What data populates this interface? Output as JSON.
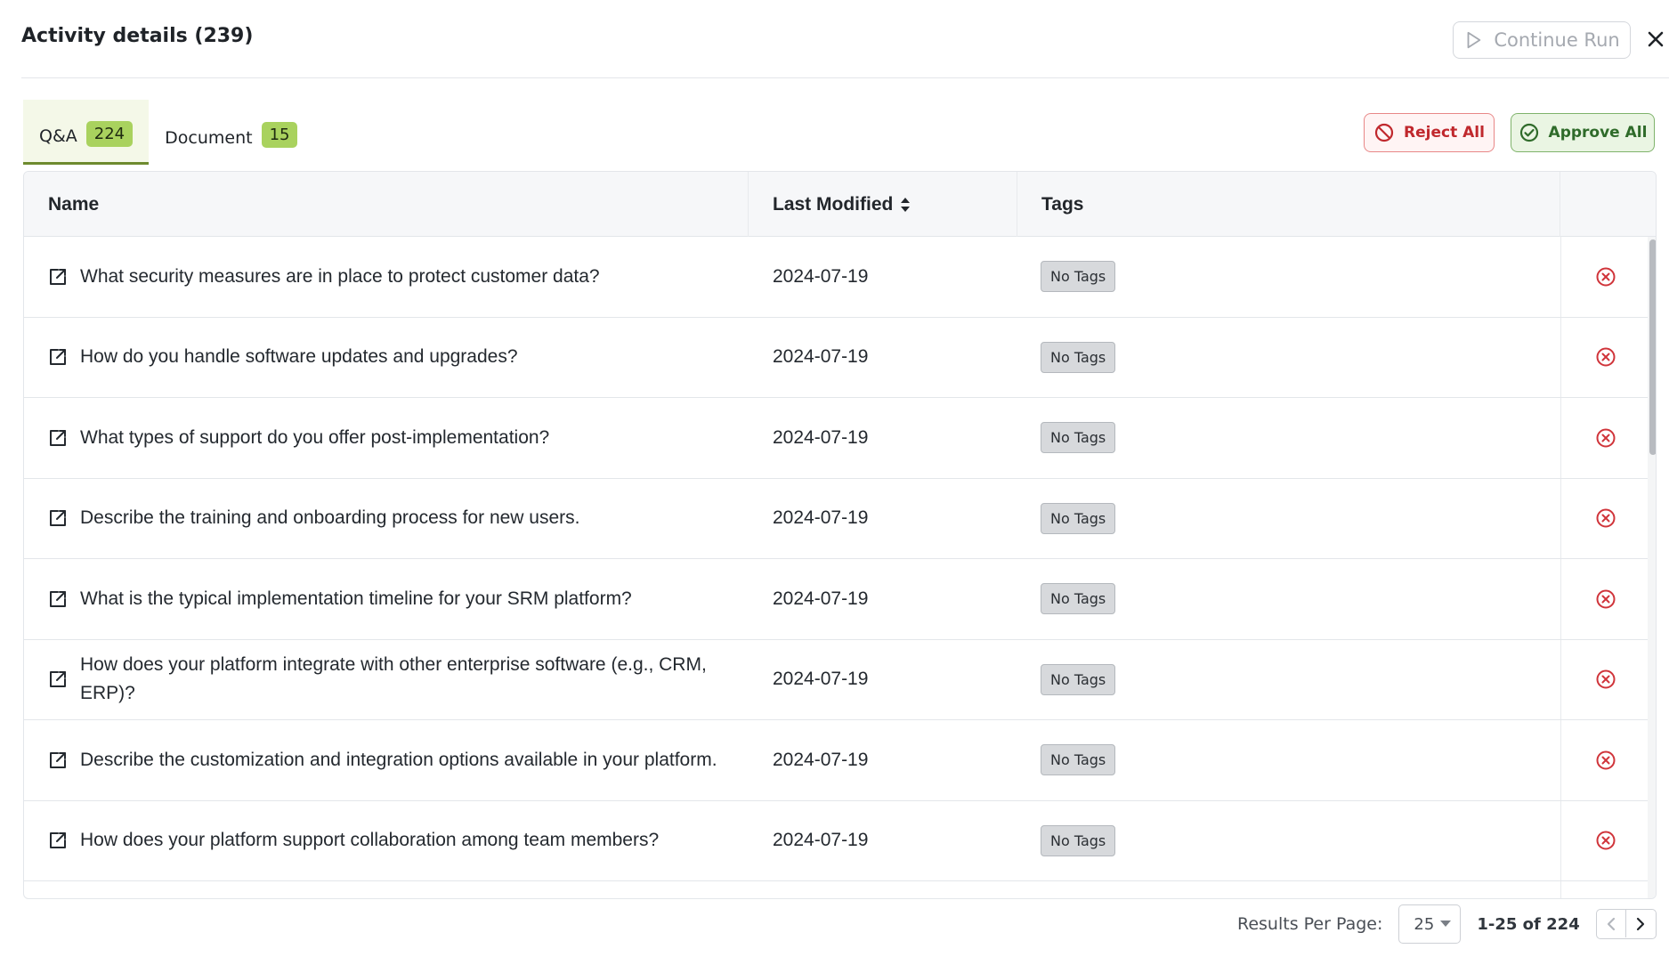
{
  "header": {
    "title": "Activity details (239)",
    "continue_label": "Continue Run"
  },
  "tabs": [
    {
      "label": "Q&A",
      "count": "224"
    },
    {
      "label": "Document",
      "count": "15"
    }
  ],
  "actions": {
    "reject_all": "Reject All",
    "approve_all": "Approve All"
  },
  "table": {
    "columns": {
      "name": "Name",
      "last_modified": "Last Modified",
      "tags": "Tags"
    },
    "rows": [
      {
        "name": "What security measures are in place to protect customer data?",
        "modified": "2024-07-19",
        "tag": "No Tags"
      },
      {
        "name": "How do you handle software updates and upgrades?",
        "modified": "2024-07-19",
        "tag": "No Tags"
      },
      {
        "name": "What types of support do you offer post-implementation?",
        "modified": "2024-07-19",
        "tag": "No Tags"
      },
      {
        "name": "Describe the training and onboarding process for new users.",
        "modified": "2024-07-19",
        "tag": "No Tags"
      },
      {
        "name": "What is the typical implementation timeline for your SRM platform?",
        "modified": "2024-07-19",
        "tag": "No Tags"
      },
      {
        "name": "How does your platform integrate with other enterprise software (e.g., CRM, ERP)?",
        "modified": "2024-07-19",
        "tag": "No Tags"
      },
      {
        "name": "Describe the customization and integration options available in your platform.",
        "modified": "2024-07-19",
        "tag": "No Tags"
      },
      {
        "name": "How does your platform support collaboration among team members?",
        "modified": "2024-07-19",
        "tag": "No Tags"
      }
    ]
  },
  "footer": {
    "results_per_page_label": "Results Per Page:",
    "results_per_page_value": "25",
    "page_info": "1-25 of 224"
  },
  "colors": {
    "accent_green": "#a9d25e",
    "reject_red": "#c0282d",
    "approve_green": "#2f6b2a"
  },
  "icons": {
    "continue": "play-icon",
    "close": "close-icon",
    "reject": "prohibited-icon",
    "approve": "check-circle-icon",
    "row_open": "external-link-icon",
    "row_remove": "x-circle-icon",
    "sort": "sort-icon"
  }
}
